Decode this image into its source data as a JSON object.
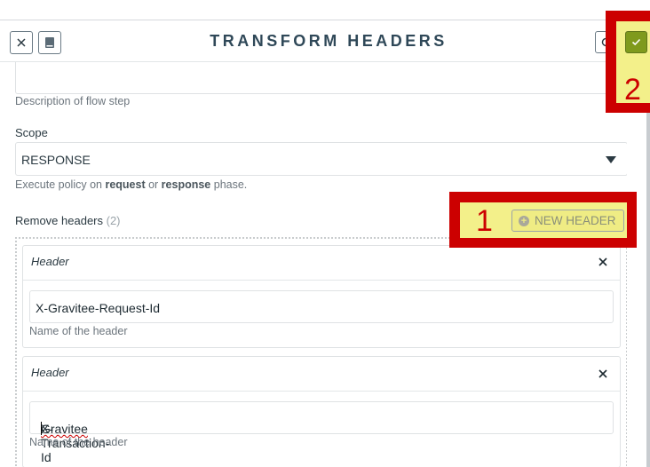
{
  "header": {
    "title": "TRANSFORM HEADERS"
  },
  "form": {
    "description_hint": "Description of flow step",
    "scope_label": "Scope",
    "scope_value": "RESPONSE",
    "scope_hint_prefix": "Execute policy on ",
    "scope_hint_request": "request",
    "scope_hint_or": " or ",
    "scope_hint_response": "response",
    "scope_hint_suffix": " phase.",
    "remove_headers_label": "Remove headers",
    "remove_headers_count": "(2)",
    "new_header_label": "NEW HEADER"
  },
  "headers": [
    {
      "title": "Header",
      "value_start": "X-Gravitee-Request-Id",
      "value_spell": "",
      "value_end": "",
      "hint": "Name of the header"
    },
    {
      "title": "Header",
      "value_start": "X-",
      "value_spell": "Gravitee",
      "value_end": "-Transaction-Id",
      "hint": "Name of the header"
    }
  ],
  "annotations": {
    "badge_1": "1",
    "badge_2": "2"
  },
  "icons": [
    "close-icon",
    "book-icon",
    "refresh-icon",
    "check-icon",
    "plus-circle-icon",
    "caret-down-icon"
  ],
  "colors": {
    "accent_green": "#7f9a1d",
    "highlight_red": "#cc0000",
    "highlight_yellow": "#f3f08a"
  }
}
